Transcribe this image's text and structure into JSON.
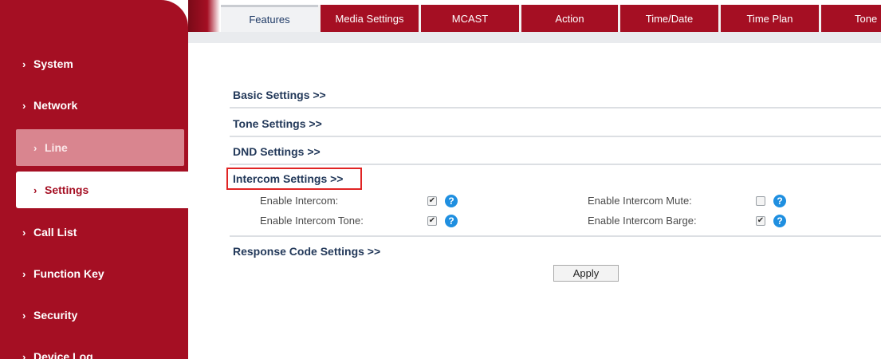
{
  "sidebar": {
    "items": [
      {
        "label": "System"
      },
      {
        "label": "Network"
      },
      {
        "label": "Line"
      },
      {
        "label": "Settings"
      },
      {
        "label": "Call List"
      },
      {
        "label": "Function Key"
      },
      {
        "label": "Security"
      },
      {
        "label": "Device Log"
      }
    ],
    "chevron": "›"
  },
  "tabs": [
    {
      "label": "Features"
    },
    {
      "label": "Media Settings"
    },
    {
      "label": "MCAST"
    },
    {
      "label": "Action"
    },
    {
      "label": "Time/Date"
    },
    {
      "label": "Time Plan"
    },
    {
      "label": "Tone"
    }
  ],
  "sections": {
    "basic": "Basic Settings >>",
    "tone": "Tone Settings >>",
    "dnd": "DND Settings >>",
    "intercom": "Intercom Settings >>",
    "response": "Response Code Settings >>"
  },
  "intercom": {
    "enable_intercom": {
      "label": "Enable Intercom:",
      "checked": true
    },
    "enable_intercom_mute": {
      "label": "Enable Intercom Mute:",
      "checked": false
    },
    "enable_intercom_tone": {
      "label": "Enable Intercom Tone:",
      "checked": true
    },
    "enable_intercom_barge": {
      "label": "Enable Intercom Barge:",
      "checked": true
    }
  },
  "apply_label": "Apply",
  "icons": {
    "help": "?",
    "check": "✔"
  },
  "colors": {
    "brand": "#a50f23",
    "help": "#1f8fe0",
    "highlight": "#e02424"
  }
}
